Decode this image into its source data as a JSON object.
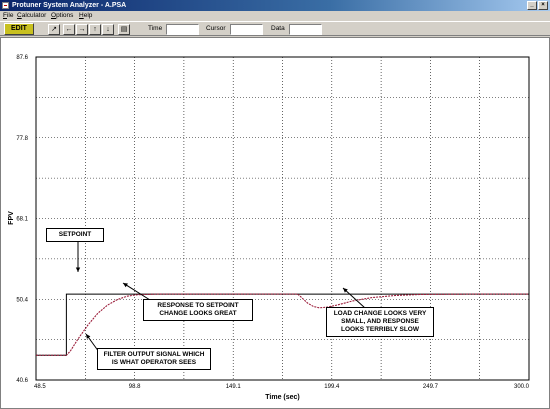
{
  "window": {
    "title": "Protuner System Analyzer - A.PSA",
    "minimize": "_",
    "close": "×"
  },
  "menu": [
    "File",
    "Calculator",
    "Options",
    "Help"
  ],
  "toolbar": {
    "edit_label": "EDIT",
    "buttons": [
      "↗",
      "←",
      "→",
      "↑",
      "↓",
      "▤"
    ],
    "fields": {
      "time_label": "Time",
      "time_value": "",
      "cursor_label": "Cursor",
      "cursor_value": "",
      "data_label": "Data",
      "data_value": ""
    }
  },
  "chart_data": {
    "type": "line",
    "xlabel": "Time (sec)",
    "ylabel": "FPV",
    "xlim": [
      48.5,
      300.0
    ],
    "ylim": [
      40.6,
      87.6
    ],
    "x_ticks": [
      "48.5",
      "98.8",
      "149.1",
      "199.4",
      "249.7",
      "300.0"
    ],
    "y_ticks": [
      "40.6",
      "50.4",
      "68.1",
      "77.8",
      "87.6"
    ],
    "grid": true,
    "series": [
      {
        "role": "setpoint",
        "color": "#000000",
        "points": [
          [
            48.5,
            44.2
          ],
          [
            64.0,
            44.2
          ],
          [
            64.0,
            53.1
          ],
          [
            300.0,
            53.1
          ]
        ]
      },
      {
        "role": "operator-signal",
        "color": "#9b1d3a",
        "points": [
          [
            48.5,
            44.2
          ],
          [
            64.0,
            44.2
          ],
          [
            66.0,
            44.8
          ],
          [
            70.0,
            46.6
          ],
          [
            75.0,
            48.6
          ],
          [
            80.0,
            50.3
          ],
          [
            85.0,
            51.5
          ],
          [
            90.0,
            52.3
          ],
          [
            95.0,
            52.8
          ],
          [
            100.0,
            53.0
          ],
          [
            110.0,
            53.1
          ],
          [
            125.0,
            53.1
          ],
          [
            150.0,
            53.1
          ],
          [
            175.0,
            53.1
          ],
          [
            182.0,
            53.1
          ],
          [
            184.0,
            52.6
          ],
          [
            187.0,
            51.8
          ],
          [
            190.0,
            51.3
          ],
          [
            193.0,
            51.1
          ],
          [
            197.0,
            51.2
          ],
          [
            202.0,
            51.5
          ],
          [
            210.0,
            52.1
          ],
          [
            220.0,
            52.6
          ],
          [
            232.0,
            52.9
          ],
          [
            245.0,
            53.05
          ],
          [
            270.0,
            53.1
          ],
          [
            300.0,
            53.1
          ]
        ]
      }
    ],
    "annotations": [
      "SETPOINT",
      "RESPONSE TO SETPOINT\nCHANGE LOOKS GREAT",
      "LOAD CHANGE LOOKS VERY\nSMALL, AND RESPONSE\nLOOKS TERRIBLY SLOW",
      "FILTER OUTPUT SIGNAL WHICH\nIS WHAT OPERATOR SEES"
    ]
  }
}
